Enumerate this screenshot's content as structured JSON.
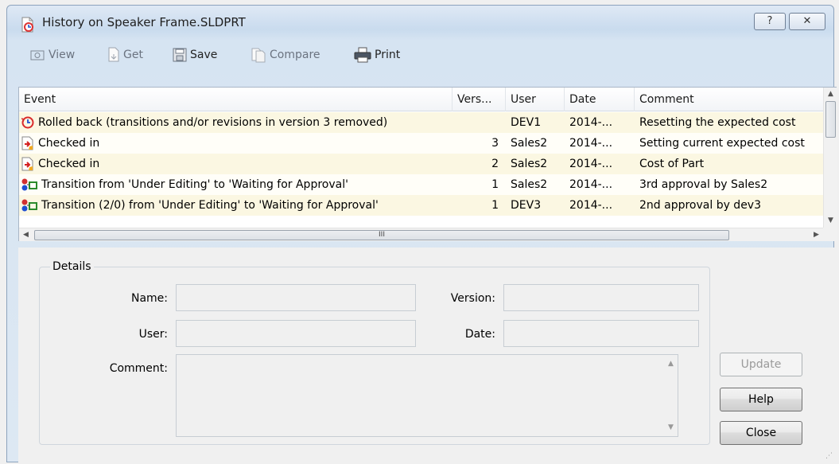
{
  "window": {
    "title": "History on Speaker Frame.SLDPRT",
    "help_glyph": "?",
    "close_glyph": "✕"
  },
  "toolbar": {
    "view": "View",
    "get": "Get",
    "save": "Save",
    "compare": "Compare",
    "print": "Print"
  },
  "table": {
    "headers": {
      "event": "Event",
      "version": "Vers...",
      "user": "User",
      "date": "Date",
      "comment": "Comment"
    },
    "rows": [
      {
        "icon": "rollback-icon",
        "event": "Rolled back (transitions and/or revisions in version 3 removed)",
        "version": "",
        "user": "DEV1",
        "date": "2014-...",
        "comment": "Resetting the expected cost"
      },
      {
        "icon": "checkin-icon",
        "event": "Checked in",
        "version": "3",
        "user": "Sales2",
        "date": "2014-...",
        "comment": "Setting current expected cost"
      },
      {
        "icon": "checkin-icon",
        "event": "Checked in",
        "version": "2",
        "user": "Sales2",
        "date": "2014-...",
        "comment": "Cost of Part"
      },
      {
        "icon": "transition-icon",
        "event": "Transition from 'Under Editing' to 'Waiting for Approval'",
        "version": "1",
        "user": "Sales2",
        "date": "2014-...",
        "comment": "3rd approval by Sales2"
      },
      {
        "icon": "transition-icon",
        "event": "Transition (2/0) from 'Under Editing' to 'Waiting for Approval'",
        "version": "1",
        "user": "DEV3",
        "date": "2014-...",
        "comment": "2nd approval by dev3"
      }
    ],
    "hscroll_glyph": "III"
  },
  "details": {
    "group_label": "Details",
    "name_label": "Name:",
    "version_label": "Version:",
    "user_label": "User:",
    "date_label": "Date:",
    "comment_label": "Comment:",
    "name_value": "",
    "version_value": "",
    "user_value": "",
    "date_value": "",
    "comment_value": ""
  },
  "buttons": {
    "update": "Update",
    "help": "Help",
    "close": "Close"
  }
}
